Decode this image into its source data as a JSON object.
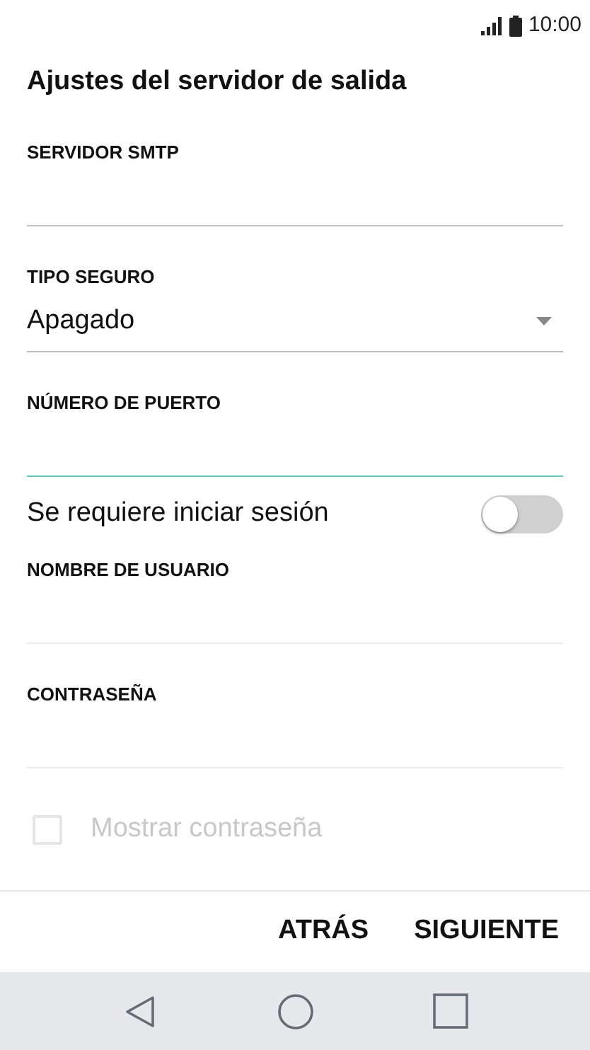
{
  "status_bar": {
    "time": "10:00"
  },
  "title": "Ajustes del servidor de salida",
  "fields": [
    {
      "kind": "input",
      "label": "SERVIDOR SMTP",
      "focused": false,
      "disabled": false
    },
    {
      "kind": "select",
      "label": "TIPO SEGURO",
      "value": "Apagado",
      "focused": false,
      "disabled": false
    },
    {
      "kind": "input",
      "label": "NÚMERO DE PUERTO",
      "focused": true,
      "disabled": false
    },
    {
      "kind": "switch",
      "label": "Se requiere iniciar sesión",
      "on": false
    },
    {
      "kind": "input",
      "label": "NOMBRE DE USUARIO",
      "focused": false,
      "disabled": true
    },
    {
      "kind": "input",
      "label": "CONTRASEÑA",
      "focused": false,
      "disabled": true
    },
    {
      "kind": "checkbox",
      "label": "Mostrar contraseña",
      "checked": false,
      "disabled": true
    }
  ],
  "buttons": [
    "ATRÁS",
    "SIGUIENTE"
  ]
}
